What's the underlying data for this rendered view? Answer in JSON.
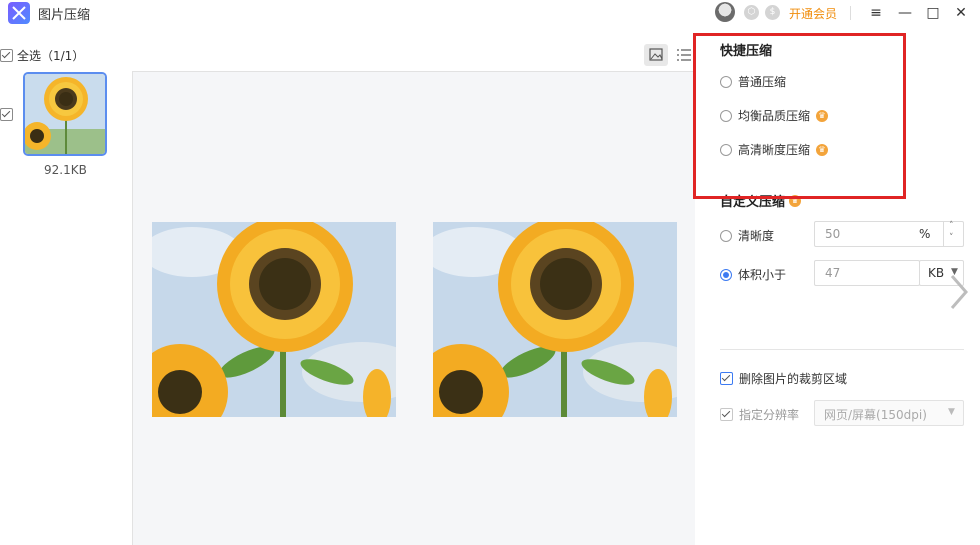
{
  "app": {
    "title": "图片压缩",
    "vip_label": "开通会员"
  },
  "window_controls": {
    "menu": "≡",
    "minimize": "—",
    "maximize": "□",
    "close": "✕"
  },
  "badges": [
    "hexagon-badge-icon",
    "dollar-badge-icon"
  ],
  "selection": {
    "select_all_label": "全选（1/1）"
  },
  "files": [
    {
      "size": "92.1KB",
      "selected": true
    }
  ],
  "quick_compress": {
    "title": "快捷压缩",
    "options": [
      {
        "label": "普通压缩",
        "vip": false,
        "selected": false
      },
      {
        "label": "均衡品质压缩",
        "vip": true,
        "selected": false
      },
      {
        "label": "高清晰度压缩",
        "vip": true,
        "selected": false
      }
    ]
  },
  "custom_compress": {
    "title": "自定义压缩",
    "clarity": {
      "label": "清晰度",
      "value": "50",
      "unit": "%",
      "selected": false
    },
    "size_limit": {
      "label": "体积小于",
      "value": "47",
      "unit": "KB",
      "selected": true
    }
  },
  "extra_options": {
    "remove_crop": {
      "label": "删除图片的裁剪区域",
      "checked": true
    },
    "resolution": {
      "label": "指定分辨率",
      "checked": true,
      "disabled": true,
      "value": "网页/屏幕(150dpi)"
    }
  },
  "colors": {
    "accent": "#3d7bf2",
    "vip": "#f08d0c",
    "highlight": "#e02424"
  }
}
